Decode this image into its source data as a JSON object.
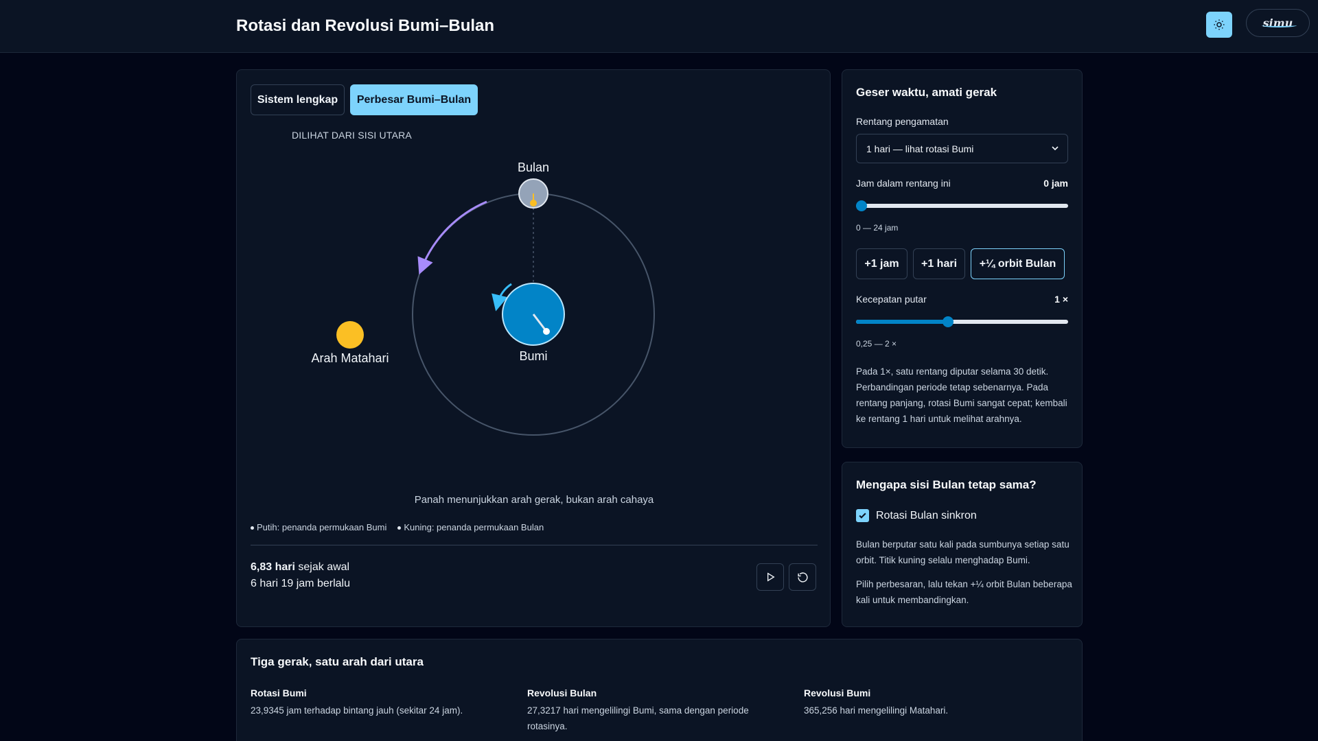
{
  "app": {
    "title": "Rotasi dan Revolusi Bumi–Bulan",
    "brand": "simu"
  },
  "sim": {
    "tabs": [
      {
        "label": "Sistem lengkap",
        "active": false
      },
      {
        "label": "Perbesar Bumi–Bulan",
        "active": true
      }
    ],
    "view_label": "DILIHAT DARI SISI UTARA",
    "labels": {
      "moon": "Bulan",
      "earth": "Bumi",
      "sun": "Arah Matahari"
    },
    "arrow_note": "Panah menunjukkan arah gerak, bukan arah cahaya",
    "legend": {
      "white": "Putih: penanda permukaan Bumi",
      "yellow": "Kuning: penanda permukaan Bulan"
    },
    "elapsed": {
      "days_value": "6,83 hari",
      "days_suffix": "sejak awal",
      "detail": "6 hari 19 jam berlalu"
    }
  },
  "controls": {
    "title": "Geser waktu, amati gerak",
    "range_label": "Rentang pengamatan",
    "range_selected": "1 hari — lihat rotasi Bumi",
    "hour_label": "Jam dalam rentang ini",
    "hour_value": "0 jam",
    "hour_fraction": 0,
    "hour_range": "0 — 24 jam",
    "steps": [
      {
        "label": "+1 jam",
        "active": false
      },
      {
        "label": "+1 hari",
        "active": false
      },
      {
        "label": "+¼ orbit Bulan",
        "active": true
      }
    ],
    "speed_label": "Kecepatan putar",
    "speed_value": "1 ×",
    "speed_fraction": 0.43,
    "speed_range": "0,25 — 2 ×",
    "note": "Pada 1×, satu rentang diputar selama 30 detik. Perbandingan periode tetap sebenarnya. Pada rentang panjang, rotasi Bumi sangat cepat; kembali ke rentang 1 hari untuk melihat arahnya."
  },
  "why": {
    "title": "Mengapa sisi Bulan tetap sama?",
    "checkbox_label": "Rotasi Bulan sinkron",
    "checked": true,
    "p1": "Bulan berputar satu kali pada sumbunya setiap satu orbit. Titik kuning selalu menghadap Bumi.",
    "p2": "Pilih perbesaran, lalu tekan +¼ orbit Bulan beberapa kali untuk membandingkan."
  },
  "motions": {
    "title": "Tiga gerak, satu arah dari utara",
    "items": [
      {
        "title": "Rotasi Bumi",
        "desc": "23,9345 jam terhadap bintang jauh (sekitar 24 jam)."
      },
      {
        "title": "Revolusi Bulan",
        "desc": "27,3217 hari mengelilingi Bumi, sama dengan periode rotasinya."
      },
      {
        "title": "Revolusi Bumi",
        "desc": "365,256 hari mengelilingi Matahari."
      }
    ]
  },
  "colors": {
    "accent": "#7dd3fc",
    "earth": "#0284c7",
    "sun": "#fbbf24",
    "moon_arrow": "#a78bfa",
    "earth_arrow": "#38bdf8"
  }
}
